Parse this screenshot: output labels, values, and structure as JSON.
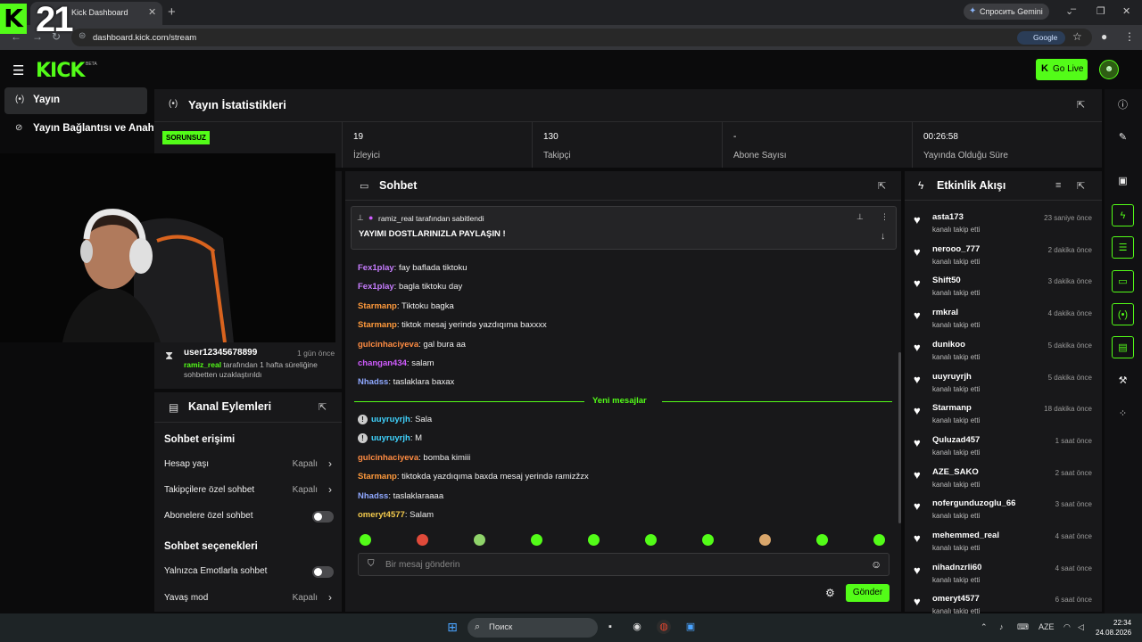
{
  "browser": {
    "tab_title": "Kick Dashboard",
    "url": "dashboard.kick.com/stream",
    "gemini_label": "Спросить Gemini",
    "search_engine": "Google"
  },
  "overlay": {
    "number": "21"
  },
  "header": {
    "logo": "KICK",
    "beta": "BETA",
    "go_live": "Go Live"
  },
  "sidebar": {
    "items": [
      {
        "label": "Yayın",
        "active": true
      },
      {
        "label": "Yayın Bağlantısı ve Anahtarı",
        "active": false
      }
    ]
  },
  "stats": {
    "title": "Yayın İstatistikleri",
    "status": "SORUNSUZ",
    "cells": [
      {
        "value": "19",
        "label": "İzleyici"
      },
      {
        "value": "130",
        "label": "Takipçi"
      },
      {
        "value": "-",
        "label": "Abone Sayısı"
      },
      {
        "value": "00:26:58",
        "label": "Yayında Olduğu Süre"
      }
    ]
  },
  "ban_notice": {
    "user": "user12345678899",
    "time": "1 gün önce",
    "moderator": "ramiz_real",
    "line1_rest": " tarafından 1 hafta süreliğine",
    "line2": "sohbetten uzaklaştırıldı"
  },
  "channel_actions": {
    "title": "Kanal Eylemleri",
    "section1": "Sohbet erişimi",
    "section2": "Sohbet seçenekleri",
    "rows": [
      {
        "label": "Hesap yaşı",
        "value": "Kapalı"
      },
      {
        "label": "Takipçilere özel sohbet",
        "value": "Kapalı"
      },
      {
        "label": "Abonelere özel sohbet",
        "value": ""
      },
      {
        "label": "Yalnızca Emotlarla sohbet",
        "value": ""
      },
      {
        "label": "Yavaş mod",
        "value": "Kapalı"
      }
    ]
  },
  "chat": {
    "title": "Sohbet",
    "pinned_by": "ramiz_real tarafından sabitlendi",
    "pinned_message": "YAYIMI DOSTLARINIZLA PAYLAŞIN !",
    "messages": [
      {
        "user": "Fex1play",
        "color": "#c77dff",
        "text": "fay baflada tiktoku"
      },
      {
        "user": "Fex1play",
        "color": "#c77dff",
        "text": "bagla tiktoku day"
      },
      {
        "user": "Starmanp",
        "color": "#ff9a3c",
        "text": "Tiktoku bagka"
      },
      {
        "user": "Starmanp",
        "color": "#ff9a3c",
        "text": "tiktok mesaj yerində yazdıqıma baxxxx"
      },
      {
        "user": "gulcinhaciyeva",
        "color": "#ff8c42",
        "text": "gal bura aa"
      },
      {
        "user": "changan434",
        "color": "#d05cff",
        "text": "salam"
      },
      {
        "user": "Nhadss",
        "color": "#8fa8ff",
        "text": "taslaklara baxax"
      }
    ],
    "new_messages_label": "Yeni mesajlar",
    "new_messages": [
      {
        "user": "uuyruyrjh",
        "color": "#40d4ff",
        "text": "Sala",
        "warn": true
      },
      {
        "user": "uuyruyrjh",
        "color": "#40d4ff",
        "text": "M",
        "warn": true
      },
      {
        "user": "gulcinhaciyeva",
        "color": "#ff8c42",
        "text": "bomba kimiii",
        "warn": false
      },
      {
        "user": "Starmanp",
        "color": "#ff9a3c",
        "text": "tiktokda yazdıqıma baxda mesaj yerində ramizžzx",
        "warn": false
      },
      {
        "user": "Nhadss",
        "color": "#8fa8ff",
        "text": "taslaklaraaaa",
        "warn": false
      },
      {
        "user": "omeryt4577",
        "color": "#f2c94c",
        "text": "Salam",
        "warn": false
      }
    ],
    "input_placeholder": "Bir mesaj gönderin",
    "send_label": "Gönder"
  },
  "activity": {
    "title": "Etkinlik Akışı",
    "items": [
      {
        "user": "asta173",
        "time": "23 saniye önce",
        "action": "kanalı takip etti"
      },
      {
        "user": "nerooo_777",
        "time": "2 dakika önce",
        "action": "kanalı takip etti"
      },
      {
        "user": "Shift50",
        "time": "3 dakika önce",
        "action": "kanalı takip etti"
      },
      {
        "user": "rmkral",
        "time": "4 dakika önce",
        "action": "kanalı takip etti"
      },
      {
        "user": "dunikoo",
        "time": "5 dakika önce",
        "action": "kanalı takip etti"
      },
      {
        "user": "uuyruyrjh",
        "time": "5 dakika önce",
        "action": "kanalı takip etti"
      },
      {
        "user": "Starmanp",
        "time": "18 dakika önce",
        "action": "kanalı takip etti"
      },
      {
        "user": "Quluzad457",
        "time": "1 saat önce",
        "action": "kanalı takip etti"
      },
      {
        "user": "AZE_SAKO",
        "time": "2 saat önce",
        "action": "kanalı takip etti"
      },
      {
        "user": "nofergunduzoglu_66",
        "time": "3 saat önce",
        "action": "kanalı takip etti"
      },
      {
        "user": "mehemmed_real",
        "time": "4 saat önce",
        "action": "kanalı takip etti"
      },
      {
        "user": "nihadnzrli60",
        "time": "4 saat önce",
        "action": "kanalı takip etti"
      },
      {
        "user": "omeryt4577",
        "time": "6 saat önce",
        "action": "kanalı takip etti"
      }
    ]
  },
  "taskbar": {
    "search_placeholder": "Поиск",
    "lang": "AZE",
    "time": "22:34",
    "date": "24.08.2026"
  },
  "colors": {
    "accent": "#53fc18",
    "panel": "#18181a",
    "background": "#0b0b0c"
  }
}
